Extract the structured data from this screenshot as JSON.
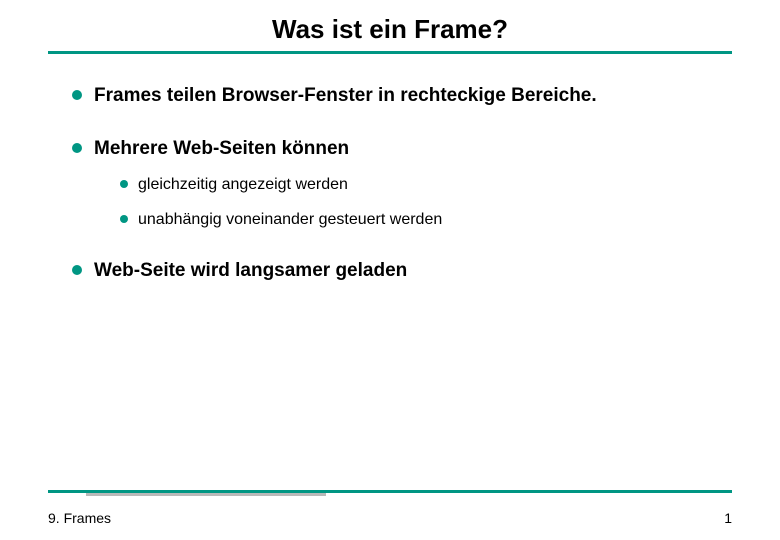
{
  "title": "Was ist ein Frame?",
  "bullets": {
    "b1": "Frames teilen Browser-Fenster in rechteckige Bereiche.",
    "b2": "Mehrere Web-Seiten können",
    "b2_sub": {
      "s1": "gleichzeitig angezeigt werden",
      "s2": "unabhängig voneinander gesteuert werden"
    },
    "b3": "Web-Seite wird langsamer geladen"
  },
  "footer": {
    "left": "9. Frames",
    "right": "1"
  }
}
